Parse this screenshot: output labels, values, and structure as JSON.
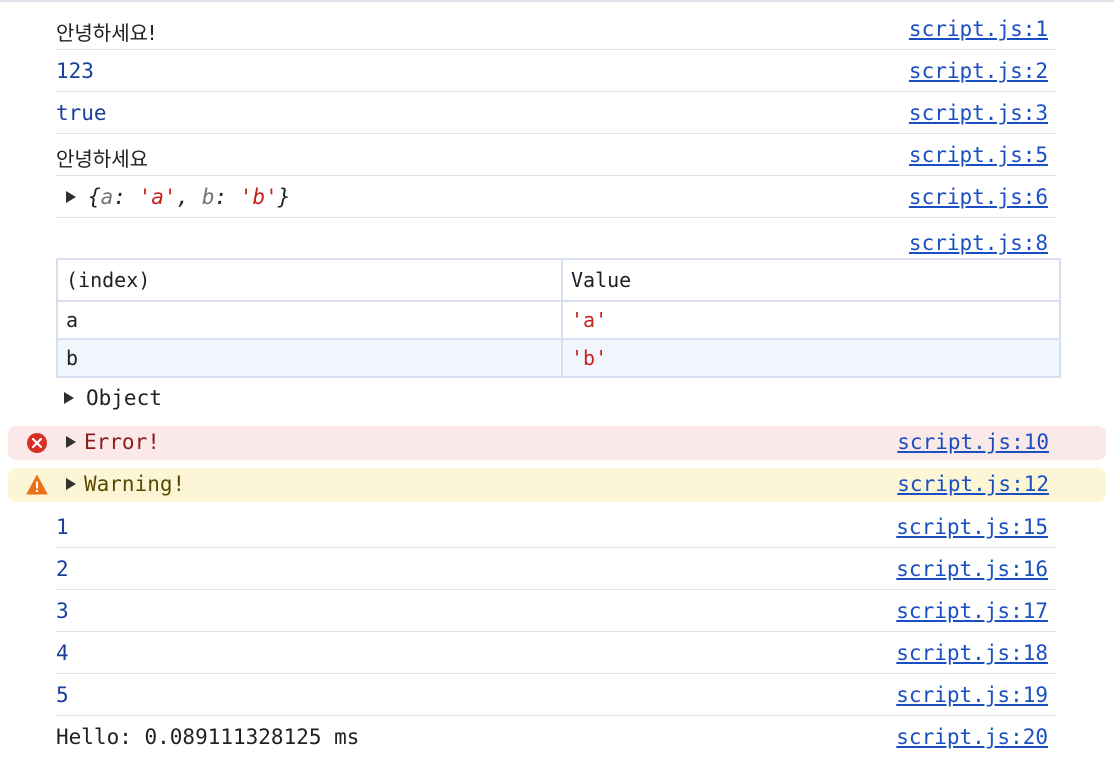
{
  "rows": [
    {
      "text": "안녕하세요!",
      "source": "script.js:1"
    },
    {
      "text": "123",
      "source": "script.js:2"
    },
    {
      "text": "true",
      "source": "script.js:3"
    },
    {
      "text": "안녕하세요",
      "source": "script.js:5"
    },
    {
      "source": "script.js:6",
      "object": {
        "open": "{",
        "k1": "a",
        "colon1": ": ",
        "v1": "'a'",
        "comma": ", ",
        "k2": "b",
        "colon2": ": ",
        "v2": "'b'",
        "close": "}"
      }
    },
    {
      "source": "script.js:8"
    }
  ],
  "table": {
    "headers": [
      "(index)",
      "Value"
    ],
    "rows": [
      {
        "index": "a",
        "value": "'a'"
      },
      {
        "index": "b",
        "value": "'b'"
      }
    ]
  },
  "object_label": "Object",
  "error": {
    "text": "Error!",
    "source": "script.js:10",
    "icon": "error-circle-icon",
    "color": "#d93025"
  },
  "warning": {
    "text": "Warning!",
    "source": "script.js:12",
    "icon": "warning-triangle-icon",
    "color": "#e8711a"
  },
  "numbers": [
    {
      "text": "1",
      "source": "script.js:15"
    },
    {
      "text": "2",
      "source": "script.js:16"
    },
    {
      "text": "3",
      "source": "script.js:17"
    },
    {
      "text": "4",
      "source": "script.js:18"
    },
    {
      "text": "5",
      "source": "script.js:19"
    }
  ],
  "timer": {
    "text": "Hello: 0.089111328125 ms",
    "source": "script.js:20"
  },
  "colors": {
    "link": "#1a4fc2",
    "number": "#1a3f9c",
    "string": "#c5221f"
  }
}
